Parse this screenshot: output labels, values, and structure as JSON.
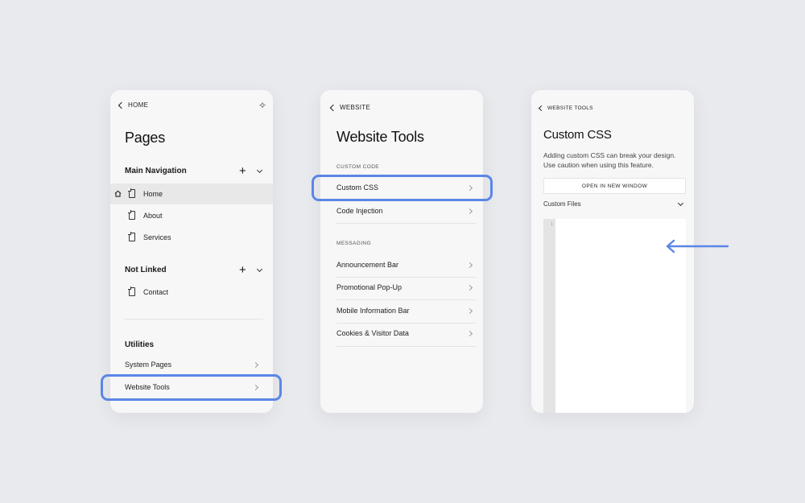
{
  "panel1": {
    "back_label": "HOME",
    "title": "Pages",
    "main_nav": {
      "heading": "Main Navigation",
      "items": [
        "Home",
        "About",
        "Services"
      ]
    },
    "not_linked": {
      "heading": "Not Linked",
      "items": [
        "Contact"
      ]
    },
    "utilities": {
      "heading": "Utilities",
      "items": [
        "System Pages",
        "Website Tools"
      ]
    },
    "highlighted_item": "Website Tools"
  },
  "panel2": {
    "back_label": "WEBSITE",
    "title": "Website Tools",
    "custom_code": {
      "heading": "CUSTOM CODE",
      "items": [
        "Custom CSS",
        "Code Injection"
      ]
    },
    "messaging": {
      "heading": "MESSAGING",
      "items": [
        "Announcement Bar",
        "Promotional Pop-Up",
        "Mobile Information Bar",
        "Cookies & Visitor Data"
      ]
    },
    "highlighted_item": "Custom CSS"
  },
  "panel3": {
    "back_label": "WEBSITE TOOLS",
    "title": "Custom CSS",
    "description": "Adding custom CSS can break your design. Use caution when using this feature.",
    "open_window_label": "OPEN IN NEW WINDOW",
    "custom_files_label": "Custom Files",
    "editor_line_number": "1"
  },
  "colors": {
    "background": "#e9eaee",
    "panel": "#f7f7f7",
    "highlight": "#5b86e6"
  }
}
